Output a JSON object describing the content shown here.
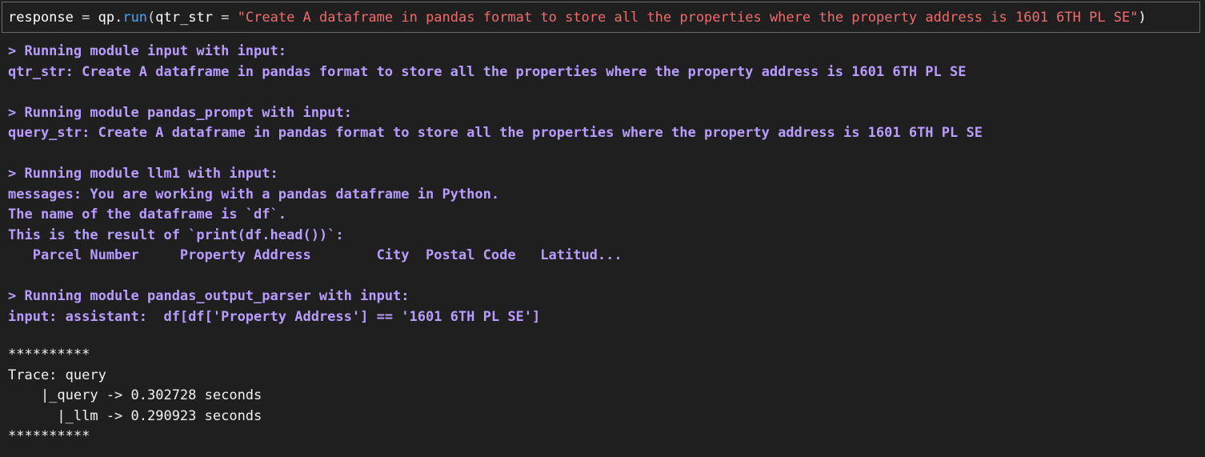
{
  "code_cell": {
    "var": "response",
    "eq": " = ",
    "obj": "qp.",
    "fn": "run",
    "open": "(",
    "arg_name": "qtr_str",
    "arg_eq": " = ",
    "string": "\"Create A dataframe in pandas format to store all the properties where the property address is 1601 6TH PL SE\"",
    "close": ")"
  },
  "output": {
    "blocks": [
      {
        "lines": [
          "> Running module input with input:",
          "qtr_str: Create A dataframe in pandas format to store all the properties where the property address is 1601 6TH PL SE"
        ]
      },
      {
        "lines": [
          "> Running module pandas_prompt with input:",
          "query_str: Create A dataframe in pandas format to store all the properties where the property address is 1601 6TH PL SE"
        ]
      },
      {
        "lines": [
          "> Running module llm1 with input:",
          "messages: You are working with a pandas dataframe in Python.",
          "The name of the dataframe is `df`.",
          "This is the result of `print(df.head())`:",
          "   Parcel Number     Property Address        City  Postal Code   Latitud..."
        ]
      },
      {
        "lines": [
          "> Running module pandas_output_parser with input:",
          "input: assistant:  df[df['Property Address'] == '1601 6TH PL SE']"
        ]
      }
    ],
    "trace": {
      "separator_top": "**********",
      "title": "Trace: query",
      "query_line": "    |_query -> 0.302728 seconds",
      "llm_line": "      |_llm -> 0.290923 seconds",
      "separator_bottom": "**********"
    }
  }
}
